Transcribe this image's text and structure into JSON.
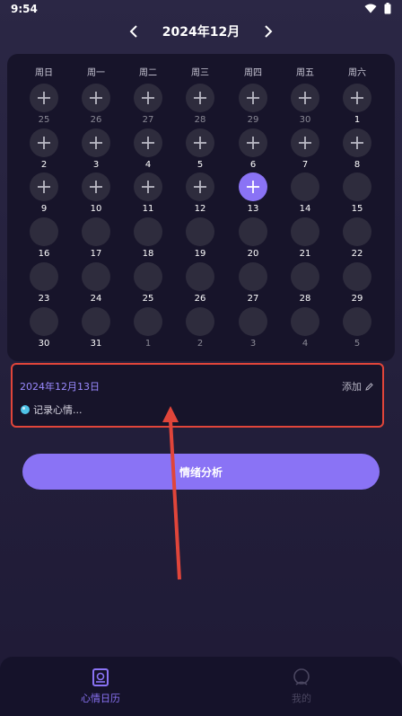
{
  "status": {
    "time": "9:54"
  },
  "nav": {
    "month_title": "2024年12月"
  },
  "weekdays": [
    "周日",
    "周一",
    "周二",
    "周三",
    "周四",
    "周五",
    "周六"
  ],
  "calendar": {
    "days": [
      {
        "label": "25",
        "in_month": false,
        "icon": "plus"
      },
      {
        "label": "26",
        "in_month": false,
        "icon": "plus"
      },
      {
        "label": "27",
        "in_month": false,
        "icon": "plus"
      },
      {
        "label": "28",
        "in_month": false,
        "icon": "plus"
      },
      {
        "label": "29",
        "in_month": false,
        "icon": "plus"
      },
      {
        "label": "30",
        "in_month": false,
        "icon": "plus"
      },
      {
        "label": "1",
        "in_month": true,
        "icon": "plus"
      },
      {
        "label": "2",
        "in_month": true,
        "icon": "plus"
      },
      {
        "label": "3",
        "in_month": true,
        "icon": "plus"
      },
      {
        "label": "4",
        "in_month": true,
        "icon": "plus"
      },
      {
        "label": "5",
        "in_month": true,
        "icon": "plus"
      },
      {
        "label": "6",
        "in_month": true,
        "icon": "plus"
      },
      {
        "label": "7",
        "in_month": true,
        "icon": "plus"
      },
      {
        "label": "8",
        "in_month": true,
        "icon": "plus"
      },
      {
        "label": "9",
        "in_month": true,
        "icon": "plus"
      },
      {
        "label": "10",
        "in_month": true,
        "icon": "plus"
      },
      {
        "label": "11",
        "in_month": true,
        "icon": "plus"
      },
      {
        "label": "12",
        "in_month": true,
        "icon": "plus"
      },
      {
        "label": "13",
        "in_month": true,
        "icon": "plus",
        "selected": true
      },
      {
        "label": "14",
        "in_month": true
      },
      {
        "label": "15",
        "in_month": true
      },
      {
        "label": "16",
        "in_month": true
      },
      {
        "label": "17",
        "in_month": true
      },
      {
        "label": "18",
        "in_month": true
      },
      {
        "label": "19",
        "in_month": true
      },
      {
        "label": "20",
        "in_month": true
      },
      {
        "label": "21",
        "in_month": true
      },
      {
        "label": "22",
        "in_month": true
      },
      {
        "label": "23",
        "in_month": true
      },
      {
        "label": "24",
        "in_month": true
      },
      {
        "label": "25",
        "in_month": true
      },
      {
        "label": "26",
        "in_month": true
      },
      {
        "label": "27",
        "in_month": true
      },
      {
        "label": "28",
        "in_month": true
      },
      {
        "label": "29",
        "in_month": true
      },
      {
        "label": "30",
        "in_month": true
      },
      {
        "label": "31",
        "in_month": true
      },
      {
        "label": "1",
        "in_month": false
      },
      {
        "label": "2",
        "in_month": false
      },
      {
        "label": "3",
        "in_month": false
      },
      {
        "label": "4",
        "in_month": false
      },
      {
        "label": "5",
        "in_month": false
      }
    ]
  },
  "record": {
    "date": "2024年12月13日",
    "add_label": "添加",
    "placeholder": "记录心情..."
  },
  "analysis_button": "情绪分析",
  "tabs": [
    {
      "label": "心情日历",
      "active": true
    },
    {
      "label": "我的",
      "active": false
    }
  ],
  "colors": {
    "accent": "#8a73f5",
    "highlight_border": "#e0453a"
  }
}
